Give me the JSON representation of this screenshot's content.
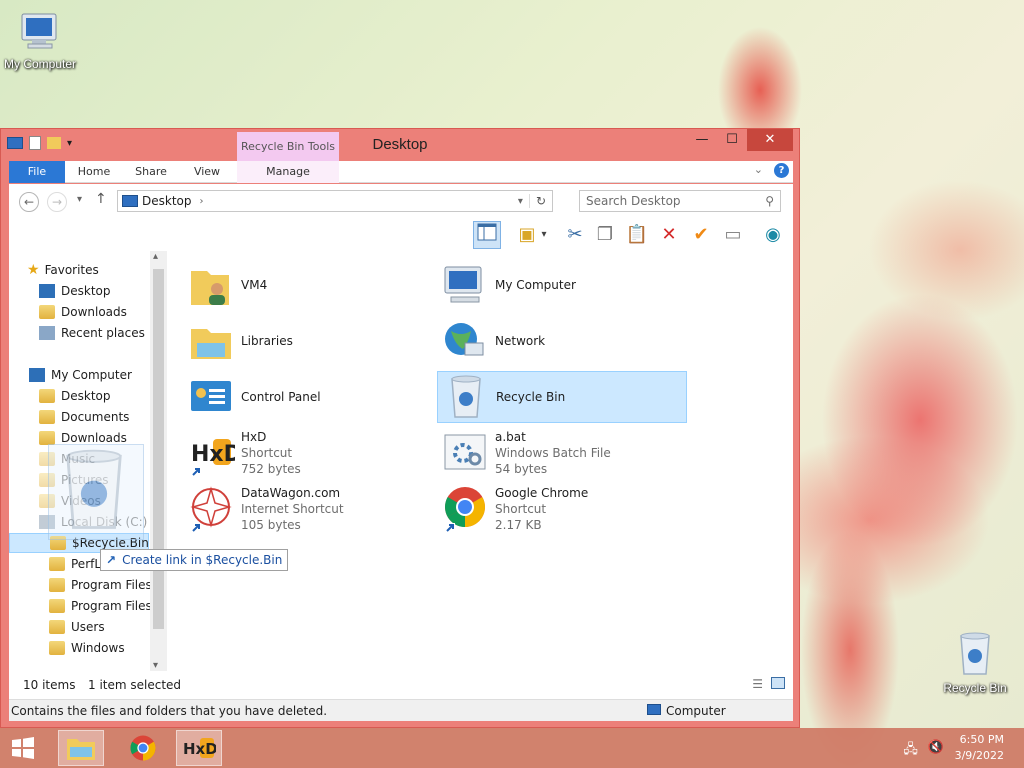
{
  "desktop": {
    "icons": [
      {
        "label": "My Computer",
        "icon": "computer-icon"
      },
      {
        "label": "Recycle Bin",
        "icon": "recycle-bin-icon"
      }
    ]
  },
  "window": {
    "title": "Desktop",
    "context_tab_header": "Recycle Bin Tools",
    "ribbon_tabs": [
      "File",
      "Home",
      "Share",
      "View",
      "Manage"
    ],
    "address": {
      "segment": "Desktop"
    },
    "search": {
      "placeholder": "Search Desktop"
    },
    "nav": {
      "favorites_label": "Favorites",
      "favorites": [
        "Desktop",
        "Downloads",
        "Recent places"
      ],
      "computer_label": "My Computer",
      "computer_items": [
        "Desktop",
        "Documents",
        "Downloads",
        "Music",
        "Pictures",
        "Videos",
        "Local Disk (C:)"
      ],
      "drive_items": [
        "$Recycle.Bin",
        "PerfLogs",
        "Program Files",
        "Program Files (",
        "Users",
        "Windows"
      ]
    },
    "items": [
      {
        "name": "VM4",
        "line2": "",
        "line3": "",
        "icon": "user-folder-icon"
      },
      {
        "name": "My Computer",
        "line2": "",
        "line3": "",
        "icon": "computer-icon"
      },
      {
        "name": "Libraries",
        "line2": "",
        "line3": "",
        "icon": "libraries-icon"
      },
      {
        "name": "Network",
        "line2": "",
        "line3": "",
        "icon": "network-icon"
      },
      {
        "name": "Control Panel",
        "line2": "",
        "line3": "",
        "icon": "control-panel-icon"
      },
      {
        "name": "Recycle Bin",
        "line2": "",
        "line3": "",
        "icon": "recycle-bin-icon"
      },
      {
        "name": "HxD",
        "line2": "Shortcut",
        "line3": "752 bytes",
        "icon": "hxd-icon"
      },
      {
        "name": "a.bat",
        "line2": "Windows Batch File",
        "line3": "54 bytes",
        "icon": "batch-file-icon"
      },
      {
        "name": "DataWagon.com",
        "line2": "Internet Shortcut",
        "line3": "105 bytes",
        "icon": "datawagon-icon"
      },
      {
        "name": "Google Chrome",
        "line2": "Shortcut",
        "line3": "2.17 KB",
        "icon": "chrome-icon"
      }
    ],
    "status": {
      "count": "10 items",
      "selected": "1 item selected"
    },
    "infobar": {
      "description": "Contains the files and folders that you have deleted.",
      "location": "Computer"
    },
    "drag_tooltip": "Create link in $Recycle.Bin"
  },
  "taskbar": {
    "time": "6:50 PM",
    "date": "3/9/2022"
  },
  "colors": {
    "accent": "#2b78d5",
    "window_frame": "#ec8079",
    "selection": "#cce8ff"
  }
}
